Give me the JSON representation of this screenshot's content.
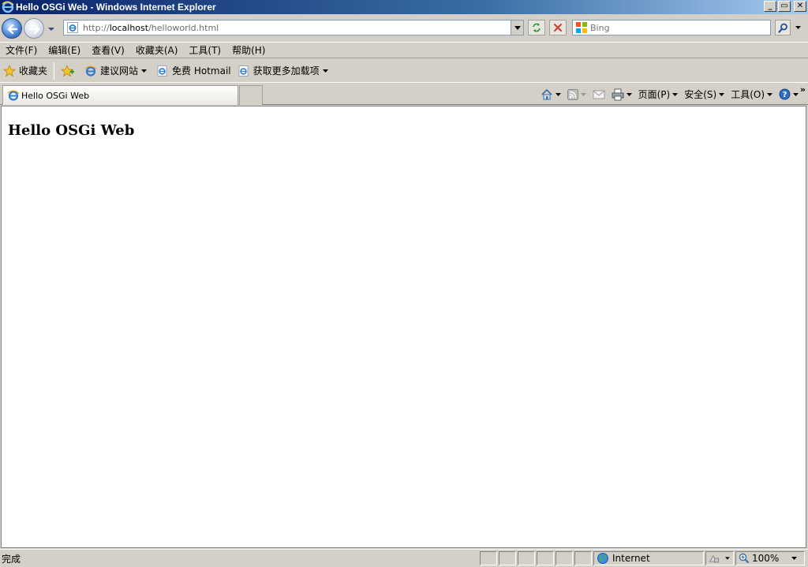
{
  "window": {
    "title": "Hello OSGi Web - Windows Internet Explorer"
  },
  "address": {
    "url_prefix": "http://",
    "url_host": "localhost",
    "url_path": "/helloworld.html"
  },
  "search": {
    "placeholder": "Bing"
  },
  "menu": {
    "items": [
      "文件(F)",
      "编辑(E)",
      "查看(V)",
      "收藏夹(A)",
      "工具(T)",
      "帮助(H)"
    ]
  },
  "favorites": {
    "favorites_label": "收藏夹",
    "suggested_sites": "建议网站",
    "free_hotmail": "免费 Hotmail",
    "more_addons": "获取更多加载项"
  },
  "tabs": [
    {
      "label": "Hello OSGi Web"
    }
  ],
  "commandbar": {
    "page": "页面(P)",
    "safety": "安全(S)",
    "tools": "工具(O)"
  },
  "content": {
    "heading": "Hello OSGi Web"
  },
  "status": {
    "text": "完成",
    "zone": "Internet",
    "zoom": "100%"
  },
  "icons": [
    "ie-icon",
    "back-icon",
    "forward-icon",
    "refresh-icon",
    "stop-icon",
    "search-icon",
    "star-icon",
    "add-favorites-icon",
    "home-icon",
    "rss-icon",
    "mail-icon",
    "print-icon",
    "help-icon",
    "globe-icon",
    "protected-mode-icon",
    "zoom-icon"
  ]
}
